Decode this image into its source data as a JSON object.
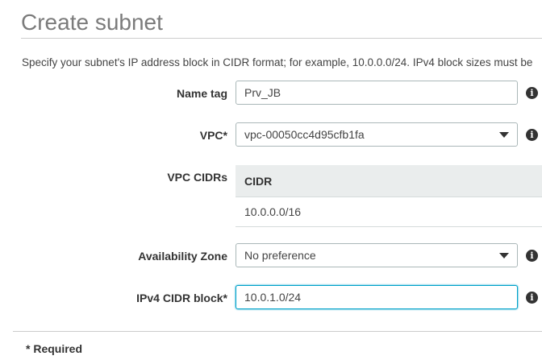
{
  "page": {
    "title": "Create subnet",
    "description": "Specify your subnet's IP address block in CIDR format; for example, 10.0.0.0/24. IPv4 block sizes must be"
  },
  "form": {
    "name_tag": {
      "label": "Name tag",
      "value": "Prv_JB"
    },
    "vpc": {
      "label": "VPC",
      "required_mark": "*",
      "value": "vpc-00050cc4d95cfb1fa"
    },
    "vpc_cidrs": {
      "label": "VPC CIDRs",
      "column_header": "CIDR",
      "rows": [
        "10.0.0.0/16"
      ]
    },
    "availability_zone": {
      "label": "Availability Zone",
      "value": "No preference"
    },
    "ipv4_cidr_block": {
      "label": "IPv4 CIDR block",
      "required_mark": "*",
      "value": "10.0.1.0/24"
    }
  },
  "info_icon_glyph": "i",
  "footer": {
    "required_note": "* Required"
  },
  "colors": {
    "focus_border": "#00a1c9",
    "table_header_bg": "#eaeded"
  }
}
